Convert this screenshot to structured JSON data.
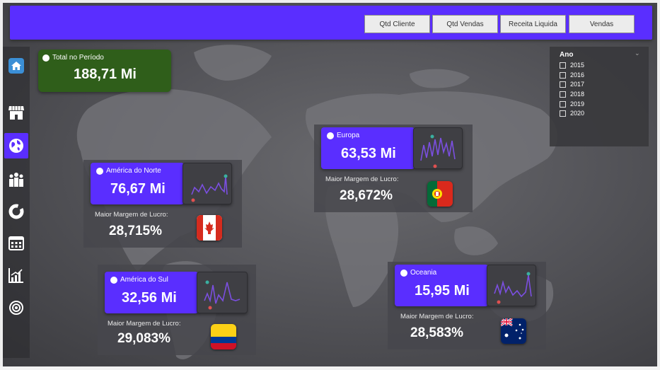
{
  "topbar": {
    "buttons": [
      "Qtd Cliente",
      "Qtd Vendas",
      "Receita Liquida",
      "Vendas"
    ],
    "color": "#5a2eff"
  },
  "sidebar": {
    "items": [
      {
        "icon": "home-icon"
      },
      {
        "icon": "store-icon"
      },
      {
        "icon": "globe-icon"
      },
      {
        "icon": "people-icon"
      },
      {
        "icon": "donut-chart-icon"
      },
      {
        "icon": "calendar-icon"
      },
      {
        "icon": "bar-chart-icon"
      },
      {
        "icon": "target-icon"
      }
    ],
    "active_index": 2
  },
  "total": {
    "label": "Total no Período",
    "value": "188,71 Mi",
    "color": "#2f5e1a"
  },
  "margin_label": "Maior Margem de Lucro:",
  "regions": [
    {
      "name": "América do Norte",
      "value": "76,67 Mi",
      "margin": "28,715%",
      "flag": "canada-flag-icon"
    },
    {
      "name": "Europa",
      "value": "63,53 Mi",
      "margin": "28,672%",
      "flag": "portugal-flag-icon"
    },
    {
      "name": "América do Sul",
      "value": "32,56 Mi",
      "margin": "29,083%",
      "flag": "colombia-flag-icon"
    },
    {
      "name": "Oceania",
      "value": "15,95 Mi",
      "margin": "28,583%",
      "flag": "australia-flag-icon"
    }
  ],
  "year_filter": {
    "title": "Ano",
    "years": [
      "2015",
      "2016",
      "2017",
      "2018",
      "2019",
      "2020"
    ]
  },
  "colors": {
    "kpi": "#5a2eff",
    "spark_line": "#7b4fe0",
    "spark_max": "#3ab0a0",
    "spark_min": "#e05050"
  }
}
